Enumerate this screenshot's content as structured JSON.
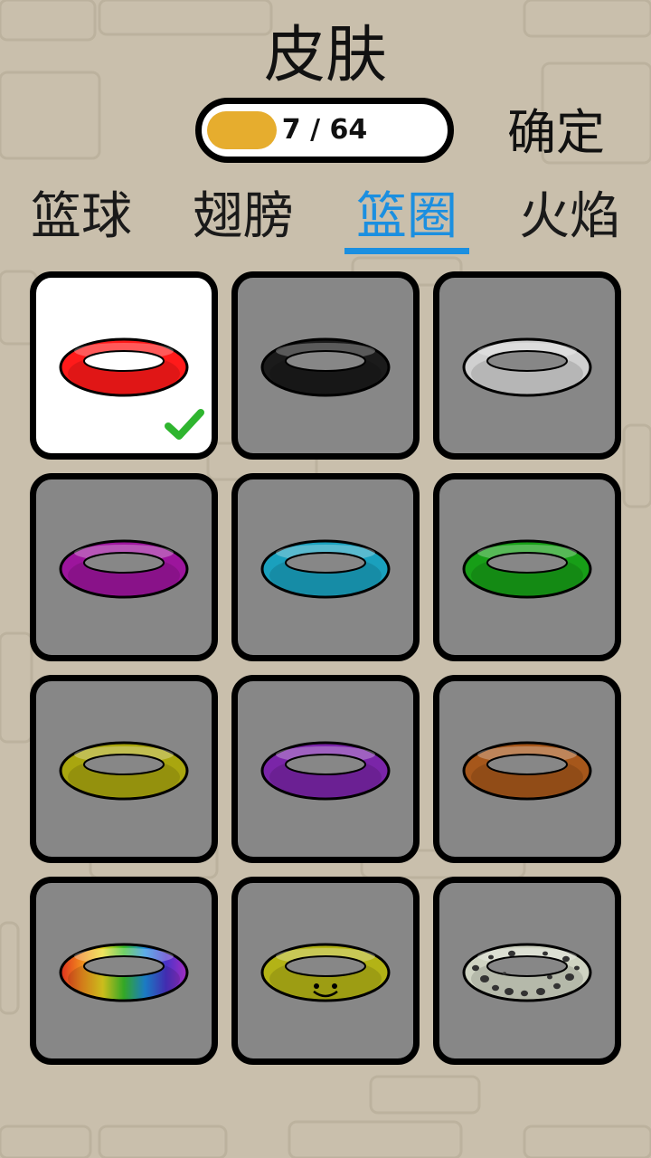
{
  "header": {
    "title": "皮肤",
    "progress_text": "7 / 64",
    "progress_fraction": 0.109,
    "confirm_label": "确定"
  },
  "tabs": [
    {
      "label": "篮球",
      "active": false
    },
    {
      "label": "翅膀",
      "active": false
    },
    {
      "label": "篮圈",
      "active": true
    },
    {
      "label": "火焰",
      "active": false
    }
  ],
  "colors": {
    "background": "#c9bfac",
    "accent": "#1b8fe0",
    "progress_fill": "#e6ad2e",
    "check": "#2fb52f"
  },
  "skins": [
    {
      "name": "red",
      "color": "#ff1a1a",
      "selected": true
    },
    {
      "name": "black",
      "color": "#1b1b1b",
      "selected": false
    },
    {
      "name": "white",
      "color": "#d0d0d0",
      "selected": false
    },
    {
      "name": "magenta",
      "color": "#9c159c",
      "selected": false
    },
    {
      "name": "cyan",
      "color": "#1aa0bd",
      "selected": false
    },
    {
      "name": "green",
      "color": "#179e17",
      "selected": false
    },
    {
      "name": "olive",
      "color": "#a9a60f",
      "selected": false
    },
    {
      "name": "purple",
      "color": "#7a25a8",
      "selected": false
    },
    {
      "name": "brown",
      "color": "#a6571b",
      "selected": false
    },
    {
      "name": "rainbow",
      "color": "rainbow",
      "selected": false
    },
    {
      "name": "smiley",
      "color": "#b3b316",
      "selected": false
    },
    {
      "name": "spotted",
      "color": "#cfd3c2",
      "selected": false
    }
  ]
}
